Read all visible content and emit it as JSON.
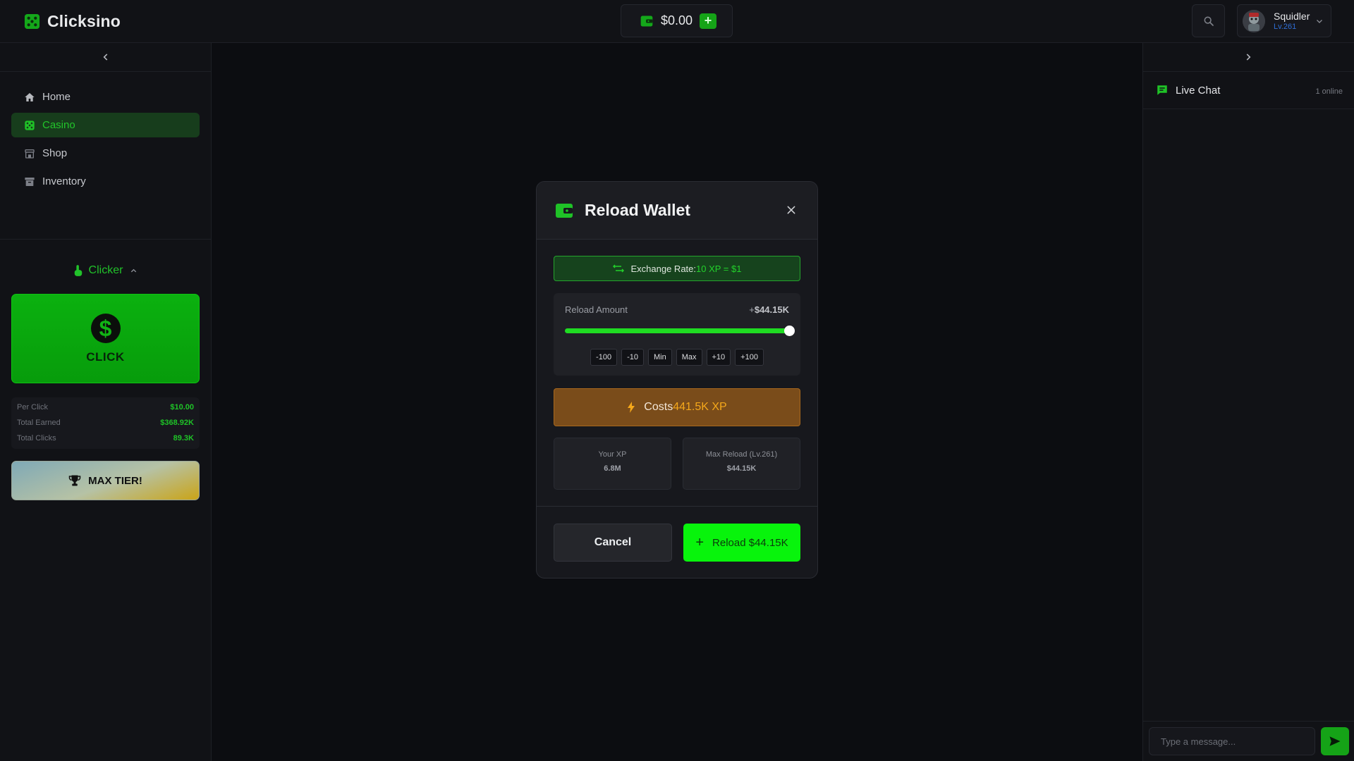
{
  "app": {
    "name": "Clicksino"
  },
  "header": {
    "balance": "$0.00",
    "add_label": "+",
    "user": {
      "name": "Squidler",
      "level": "Lv.261"
    }
  },
  "sidebar": {
    "items": [
      {
        "label": "Home",
        "icon": "home-icon",
        "active": false
      },
      {
        "label": "Casino",
        "icon": "dice-icon",
        "active": true
      },
      {
        "label": "Shop",
        "icon": "shop-icon",
        "active": false
      },
      {
        "label": "Inventory",
        "icon": "inventory-icon",
        "active": false
      }
    ]
  },
  "clicker": {
    "title": "Clicker",
    "button_symbol": "$",
    "button_label": "CLICK",
    "stats": [
      {
        "label": "Per Click",
        "value": "$10.00"
      },
      {
        "label": "Total Earned",
        "value": "$368.92K"
      },
      {
        "label": "Total Clicks",
        "value": "89.3K"
      }
    ],
    "tier_label": "MAX TIER!"
  },
  "chat": {
    "title": "Live Chat",
    "online": "1 online",
    "placeholder": "Type a message..."
  },
  "modal": {
    "title": "Reload Wallet",
    "close_label": "✕",
    "exchange_label": "Exchange Rate:",
    "exchange_value": "10 XP = $1",
    "amount_label": "Reload Amount",
    "amount_prefix": "+",
    "amount_value": "$44.15K",
    "slider_fraction": 1.0,
    "steps": [
      "-100",
      "-10",
      "Min",
      "Max",
      "+10",
      "+100"
    ],
    "cost_label": "Costs",
    "cost_value": "441.5K XP",
    "your_xp_label": "Your XP",
    "your_xp_value": "6.8M",
    "max_reload_label": "Max Reload (Lv.261)",
    "max_reload_value": "$44.15K",
    "cancel_label": "Cancel",
    "reload_label": "Reload $44.15K"
  },
  "colors": {
    "accent": "#15a317",
    "bright_green": "#08f40c",
    "background": "#0c0d11",
    "cost_orange": "#f5a81a"
  }
}
